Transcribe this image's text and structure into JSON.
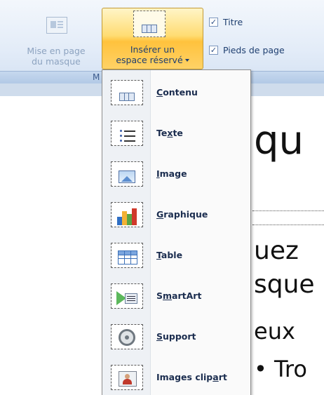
{
  "ribbon": {
    "btn_masque_line1": "Mise en page",
    "btn_masque_line2": "du masque",
    "btn_inserer_line1": "Insérer un",
    "btn_inserer_line2": "espace réservé",
    "checkboxes": [
      {
        "label": "Titre",
        "checked": true
      },
      {
        "label": "Pieds de page",
        "checked": true
      }
    ],
    "group_label": "M"
  },
  "menu": {
    "items": [
      {
        "pre": "",
        "key": "C",
        "post": "ontenu",
        "icon": "content-placeholder-icon"
      },
      {
        "pre": "Te",
        "key": "x",
        "post": "te",
        "icon": "text-placeholder-icon"
      },
      {
        "pre": "",
        "key": "I",
        "post": "mage",
        "icon": "image-placeholder-icon"
      },
      {
        "pre": "",
        "key": "G",
        "post": "raphique",
        "icon": "chart-placeholder-icon"
      },
      {
        "pre": "",
        "key": "T",
        "post": "able",
        "icon": "table-placeholder-icon"
      },
      {
        "pre": "S",
        "key": "m",
        "post": "artArt",
        "icon": "smartart-placeholder-icon"
      },
      {
        "pre": "",
        "key": "S",
        "post": "upport",
        "icon": "media-placeholder-icon"
      },
      {
        "pre": "Images clip",
        "key": "a",
        "post": "rt",
        "icon": "clipart-placeholder-icon"
      }
    ]
  },
  "slide": {
    "frag_title": "qu",
    "frag_line1": "uez",
    "frag_line2": "sque",
    "frag_line3": "eux",
    "frag_bullet": "• Tro"
  }
}
